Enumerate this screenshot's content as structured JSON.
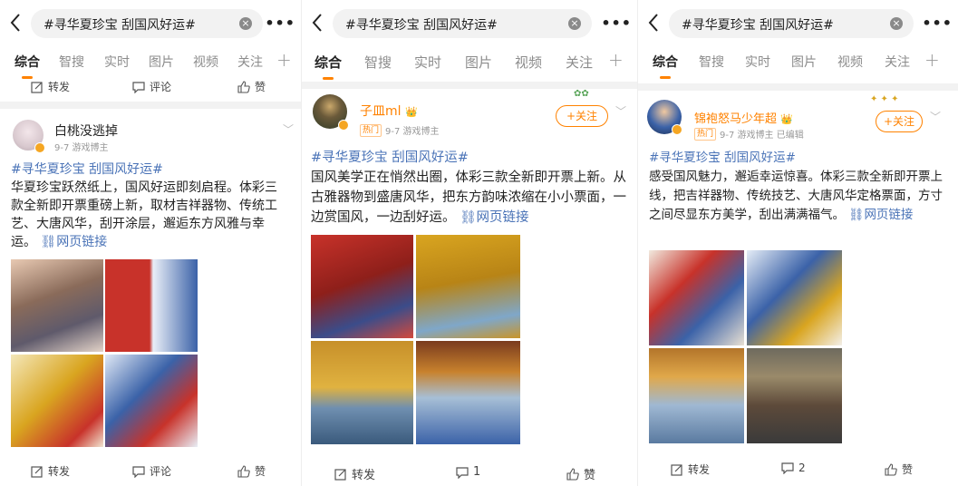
{
  "search_query": "#寻华夏珍宝 刮国风好运#",
  "tabs": [
    "综合",
    "智搜",
    "实时",
    "图片",
    "视频",
    "关注"
  ],
  "plus_glyph": "+",
  "more_glyph": "•••",
  "clear_glyph": "×",
  "actions": {
    "repost": "转发",
    "comment": "评论",
    "like": "赞"
  },
  "follow_label": "+关注",
  "panels": [
    {
      "top_actions": {
        "repost": "转发",
        "comment": "评论",
        "like": "赞"
      },
      "user": {
        "name": "白桃没逃掉",
        "meta": "9-7 游戏博主"
      },
      "hashtag": "#寻华夏珍宝 刮国风好运#",
      "text": "华夏珍宝跃然纸上，国风好运即刻启程。体彩三款全新即开票重磅上新，取材吉祥器物、传统工艺、大唐风华，刮开涂层，邂逅东方风雅与幸运。",
      "link": "网页链接",
      "bottom_actions": {
        "repost": "转发",
        "comment": "评论",
        "like": "赞"
      }
    },
    {
      "user": {
        "name": "子皿ml",
        "hot": "热门",
        "meta": "9-7 游戏博主"
      },
      "hashtag": "#寻华夏珍宝 刮国风好运#",
      "text": "国风美学正在悄然出圈，体彩三款全新即开票上新。从古雅器物到盛唐风华，把东方韵味浓缩在小小票面，一边赏国风，一边刮好运。",
      "link": "网页链接",
      "bottom_actions": {
        "repost": "转发",
        "comment": "1",
        "like": "赞"
      }
    },
    {
      "user": {
        "name": "锦袍怒马少年超",
        "hot": "热门",
        "meta": "9-7 游戏博主 已编辑"
      },
      "hashtag": "#寻华夏珍宝 刮国风好运#",
      "text": "感受国风魅力，邂逅幸运惊喜。体彩三款全新即开票上线，把吉祥器物、传统技艺、大唐风华定格票面，方寸之间尽显东方美学，刮出满满福气。",
      "link": "网页链接",
      "bottom_actions": {
        "repost": "转发",
        "comment": "2",
        "like": "赞"
      }
    }
  ],
  "colors": {
    "accent": "#ff8200",
    "link": "#4a73b7",
    "ticket_red": "#c8322a",
    "ticket_blue": "#3b62a8",
    "ticket_gold": "#d9a520"
  }
}
